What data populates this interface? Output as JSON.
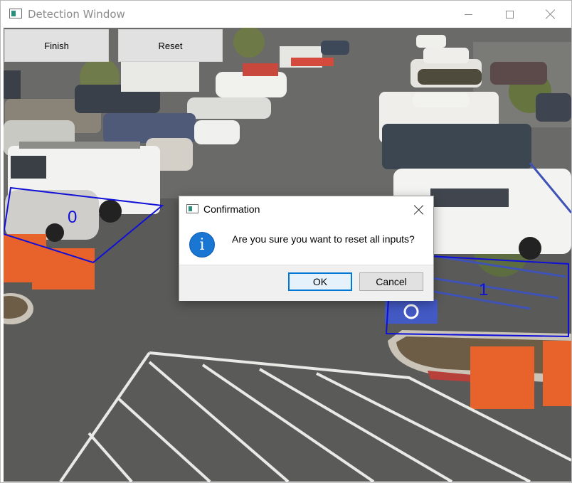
{
  "window": {
    "title": "Detection Window",
    "icon": "app-window-icon"
  },
  "toolbar": {
    "finish_label": "Finish",
    "reset_label": "Reset"
  },
  "regions": [
    {
      "label": "0",
      "color": "#1010d8"
    },
    {
      "label": "1",
      "color": "#1010d8"
    }
  ],
  "dialog": {
    "title": "Confirmation",
    "message": "Are you sure you want to reset all inputs?",
    "icon": "info-icon",
    "ok_label": "OK",
    "cancel_label": "Cancel"
  },
  "colors": {
    "accent": "#0078d7",
    "info_icon": "#1976d2",
    "region_outline": "#1010d8"
  }
}
